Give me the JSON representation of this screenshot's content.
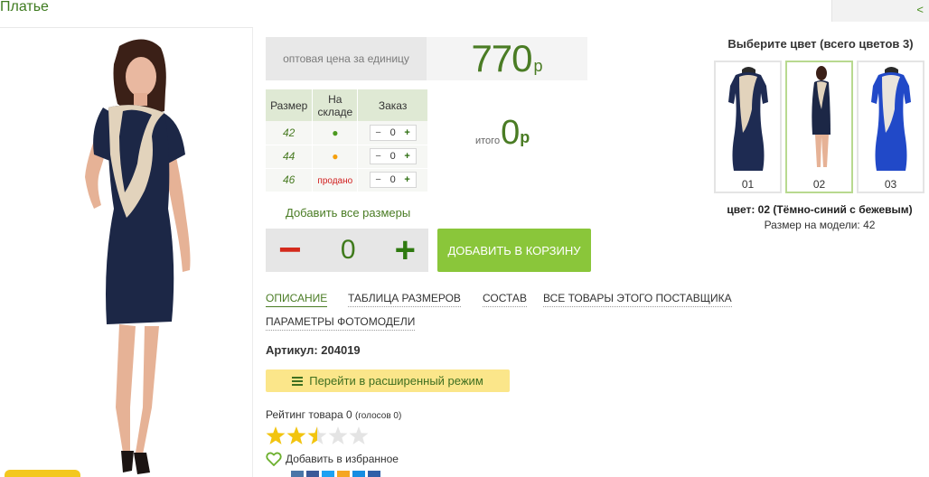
{
  "product": {
    "title": "Платье",
    "collapse_glyph": "<"
  },
  "price": {
    "label": "оптовая цена за единицу",
    "value": "770",
    "currency": "р"
  },
  "size_table": {
    "headers": [
      "Размер",
      "На складе",
      "Заказ"
    ],
    "rows": [
      {
        "size": "42",
        "stock": "●",
        "stock_status": "in-stock",
        "qty": "0"
      },
      {
        "size": "44",
        "stock": "●",
        "stock_status": "low-stock",
        "qty": "0"
      },
      {
        "size": "46",
        "stock": "продано",
        "stock_status": "sold",
        "qty": "0"
      }
    ]
  },
  "total": {
    "label": "итого",
    "value": "0",
    "currency": "р"
  },
  "add_all_sizes": "Добавить все размеры",
  "quantity": {
    "minus": "−",
    "value": "0",
    "plus": "+"
  },
  "add_to_cart": "ДОБАВИТЬ В КОРЗИНУ",
  "tabs": [
    {
      "label": "ОПИСАНИЕ",
      "active": true
    },
    {
      "label": "ТАБЛИЦА РАЗМЕРОВ",
      "active": false
    },
    {
      "label": "СОСТАВ",
      "active": false
    },
    {
      "label": "ВСЕ ТОВАРЫ ЭТОГО ПОСТАВЩИКА",
      "active": false
    },
    {
      "label": "ПАРАМЕТРЫ ФОТОМОДЕЛИ",
      "active": false
    }
  ],
  "article": "Артикул: 204019",
  "extended_mode": "Перейти в расширенный режим",
  "rating": {
    "label": "Рейтинг товара 0",
    "votes": "(голосов 0)",
    "stars_value": 2.5,
    "stars_max": 5
  },
  "favorite": "Добавить в избранное",
  "colors": {
    "title": "Выберите цвет (всего цветов 3)",
    "options": [
      {
        "number": "01",
        "color": "#1e2b52",
        "selected": false
      },
      {
        "number": "02",
        "color": "#1c2746",
        "selected": true
      },
      {
        "number": "03",
        "color": "#2149c8",
        "selected": false
      }
    ],
    "selected_caption": "цвет: 02 (Тёмно-синий с бежевым)",
    "model_size": "Размер на модели: 42"
  },
  "theme": {
    "accent_green": "#4a7c24",
    "button_green": "#8ac63a",
    "minus_red": "#d42a1c",
    "highlight_yellow": "#fbe68a"
  }
}
